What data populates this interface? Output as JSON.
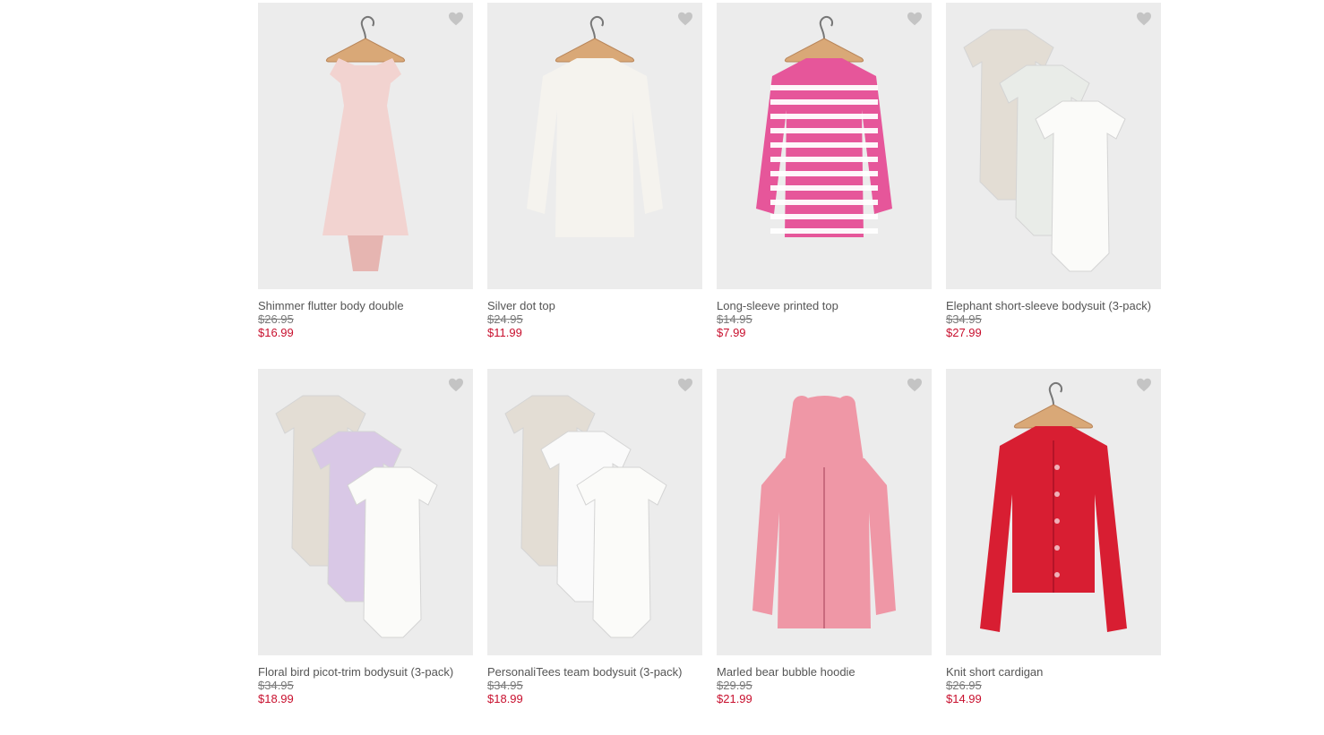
{
  "theme": {
    "photo_bg": "#ececec",
    "sale_price_color": "#c8102e",
    "heart_color": "#c4c4c4"
  },
  "products": [
    {
      "name": "Shimmer flutter body double",
      "was_price": "$26.95",
      "sale_price": "$16.99",
      "icon": "pink-flutter-bodysuit-image",
      "garment": "dress",
      "color": "#f2d3d0"
    },
    {
      "name": "Silver dot top",
      "was_price": "$24.95",
      "sale_price": "$11.99",
      "icon": "white-blouse-image",
      "garment": "top",
      "color": "#f5f3ee"
    },
    {
      "name": "Long-sleeve printed top",
      "was_price": "$14.95",
      "sale_price": "$7.99",
      "icon": "pink-striped-top-image",
      "garment": "striped",
      "color": "#e6569a"
    },
    {
      "name": "Elephant short-sleeve bodysuit (3-pack)",
      "was_price": "$34.95",
      "sale_price": "$27.99",
      "icon": "elephant-bodysuit-pack-image",
      "garment": "pack",
      "color": "#e9ece8"
    },
    {
      "name": "Floral bird picot-trim bodysuit (3-pack)",
      "was_price": "$34.95",
      "sale_price": "$18.99",
      "icon": "floral-bodysuit-pack-image",
      "garment": "pack",
      "color": "#d9c8e6"
    },
    {
      "name": "PersonaliTees team bodysuit (3-pack)",
      "was_price": "$34.95",
      "sale_price": "$18.99",
      "icon": "team-bodysuit-pack-image",
      "garment": "pack",
      "color": "#fafafa"
    },
    {
      "name": "Marled bear bubble hoodie",
      "was_price": "$29.95",
      "sale_price": "$21.99",
      "icon": "pink-bear-hoodie-image",
      "garment": "hoodie",
      "color": "#ef97a6"
    },
    {
      "name": "Knit short cardigan",
      "was_price": "$26.95",
      "sale_price": "$14.99",
      "icon": "red-cardigan-image",
      "garment": "cardigan",
      "color": "#d81e32"
    }
  ]
}
